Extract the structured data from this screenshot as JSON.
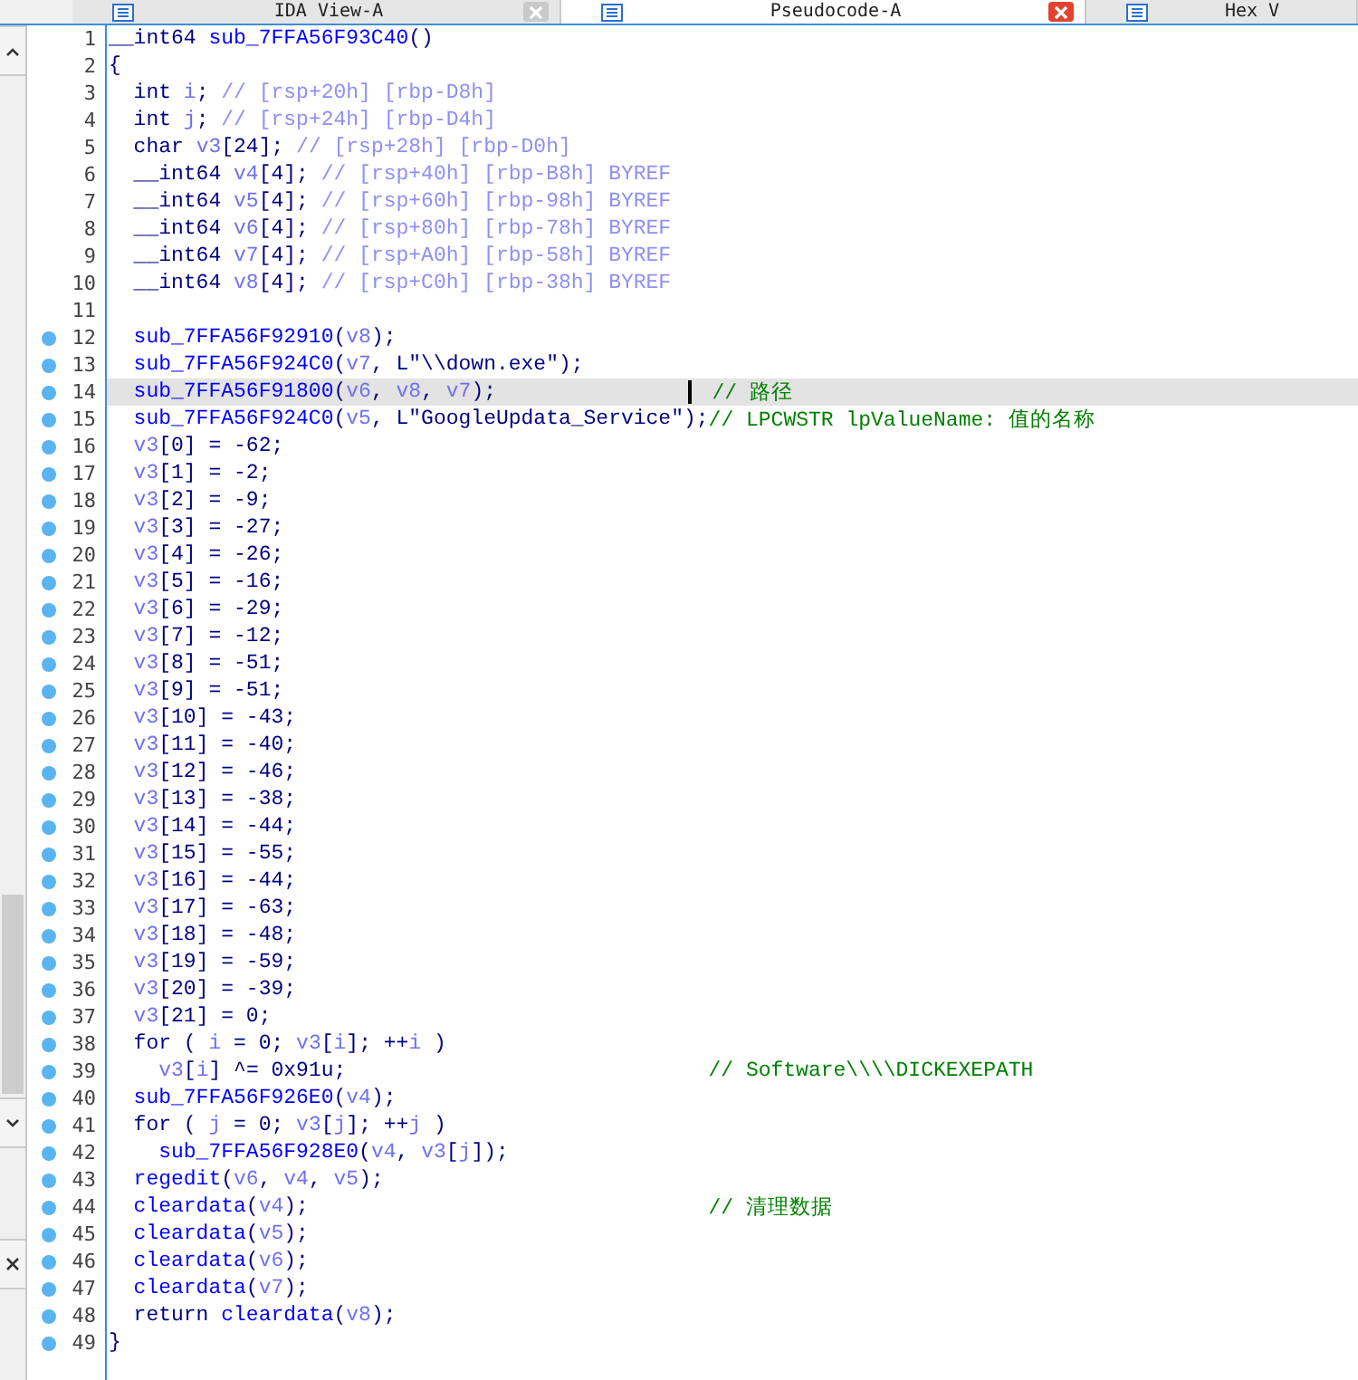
{
  "tabs": [
    {
      "label": "IDA View-A",
      "selected": false
    },
    {
      "label": "Pseudocode-A",
      "selected": true
    },
    {
      "label": "Hex V",
      "selected": false
    }
  ],
  "code": {
    "lines": [
      {
        "number": "1",
        "dot": false,
        "current": false,
        "tokens": [
          {
            "kind": "plain",
            "text": "__int64 "
          },
          {
            "kind": "func",
            "text": "sub_7FFA56F93C40"
          },
          {
            "kind": "plain",
            "text": "()"
          }
        ]
      },
      {
        "number": "2",
        "dot": false,
        "current": false,
        "tokens": [
          {
            "kind": "plain",
            "text": "{"
          }
        ]
      },
      {
        "number": "3",
        "dot": false,
        "current": false,
        "tokens": [
          {
            "kind": "plain",
            "text": "  int "
          },
          {
            "kind": "var",
            "text": "i"
          },
          {
            "kind": "plain",
            "text": "; "
          },
          {
            "kind": "stack",
            "text": "// [rsp+20h] [rbp-D8h]"
          }
        ]
      },
      {
        "number": "4",
        "dot": false,
        "current": false,
        "tokens": [
          {
            "kind": "plain",
            "text": "  int "
          },
          {
            "kind": "var",
            "text": "j"
          },
          {
            "kind": "plain",
            "text": "; "
          },
          {
            "kind": "stack",
            "text": "// [rsp+24h] [rbp-D4h]"
          }
        ]
      },
      {
        "number": "5",
        "dot": false,
        "current": false,
        "tokens": [
          {
            "kind": "plain",
            "text": "  char "
          },
          {
            "kind": "var",
            "text": "v3"
          },
          {
            "kind": "plain",
            "text": "[24]; "
          },
          {
            "kind": "stack",
            "text": "// [rsp+28h] [rbp-D0h]"
          }
        ]
      },
      {
        "number": "6",
        "dot": false,
        "current": false,
        "tokens": [
          {
            "kind": "plain",
            "text": "  __int64 "
          },
          {
            "kind": "var",
            "text": "v4"
          },
          {
            "kind": "plain",
            "text": "[4]; "
          },
          {
            "kind": "stack",
            "text": "// [rsp+40h] [rbp-B8h] BYREF"
          }
        ]
      },
      {
        "number": "7",
        "dot": false,
        "current": false,
        "tokens": [
          {
            "kind": "plain",
            "text": "  __int64 "
          },
          {
            "kind": "var",
            "text": "v5"
          },
          {
            "kind": "plain",
            "text": "[4]; "
          },
          {
            "kind": "stack",
            "text": "// [rsp+60h] [rbp-98h] BYREF"
          }
        ]
      },
      {
        "number": "8",
        "dot": false,
        "current": false,
        "tokens": [
          {
            "kind": "plain",
            "text": "  __int64 "
          },
          {
            "kind": "var",
            "text": "v6"
          },
          {
            "kind": "plain",
            "text": "[4]; "
          },
          {
            "kind": "stack",
            "text": "// [rsp+80h] [rbp-78h] BYREF"
          }
        ]
      },
      {
        "number": "9",
        "dot": false,
        "current": false,
        "tokens": [
          {
            "kind": "plain",
            "text": "  __int64 "
          },
          {
            "kind": "var",
            "text": "v7"
          },
          {
            "kind": "plain",
            "text": "[4]; "
          },
          {
            "kind": "stack",
            "text": "// [rsp+A0h] [rbp-58h] BYREF"
          }
        ]
      },
      {
        "number": "10",
        "dot": false,
        "current": false,
        "tokens": [
          {
            "kind": "plain",
            "text": "  __int64 "
          },
          {
            "kind": "var",
            "text": "v8"
          },
          {
            "kind": "plain",
            "text": "[4]; "
          },
          {
            "kind": "stack",
            "text": "// [rsp+C0h] [rbp-38h] BYREF"
          }
        ]
      },
      {
        "number": "11",
        "dot": false,
        "current": false
      },
      {
        "number": "12",
        "dot": true,
        "current": false,
        "tokens": [
          {
            "kind": "func",
            "text": "  sub_7FFA56F92910"
          },
          {
            "kind": "plain",
            "text": "("
          },
          {
            "kind": "var",
            "text": "v8"
          },
          {
            "kind": "plain",
            "text": ");"
          }
        ]
      },
      {
        "number": "13",
        "dot": true,
        "current": false,
        "tokens": [
          {
            "kind": "func",
            "text": "  sub_7FFA56F924C0"
          },
          {
            "kind": "plain",
            "text": "("
          },
          {
            "kind": "var",
            "text": "v7"
          },
          {
            "kind": "plain",
            "text": ", L\"\\\\down.exe\");"
          }
        ]
      },
      {
        "number": "14",
        "dot": true,
        "current": true,
        "tokens": [
          {
            "kind": "func",
            "text": "  sub_7FFA56F91800"
          },
          {
            "kind": "plain",
            "text": "("
          },
          {
            "kind": "var",
            "text": "v6"
          },
          {
            "kind": "plain",
            "text": ", "
          },
          {
            "kind": "var",
            "text": "v8"
          },
          {
            "kind": "plain",
            "text": ", "
          },
          {
            "kind": "var",
            "text": "v7"
          },
          {
            "kind": "plain",
            "text": ");"
          }
        ],
        "comment": "// 路径"
      },
      {
        "number": "15",
        "dot": true,
        "current": false,
        "tokens": [
          {
            "kind": "func",
            "text": "  sub_7FFA56F924C0"
          },
          {
            "kind": "plain",
            "text": "("
          },
          {
            "kind": "var",
            "text": "v5"
          },
          {
            "kind": "plain",
            "text": ", L\"GoogleUpdata_Service\");"
          }
        ],
        "comment": "// LPCWSTR lpValueName: 值的名称"
      },
      {
        "number": "16",
        "dot": true,
        "current": false,
        "tokens": [
          {
            "kind": "var",
            "text": "  v3"
          },
          {
            "kind": "plain",
            "text": "[0] = -62;"
          }
        ]
      },
      {
        "number": "17",
        "dot": true,
        "current": false,
        "tokens": [
          {
            "kind": "var",
            "text": "  v3"
          },
          {
            "kind": "plain",
            "text": "[1] = -2;"
          }
        ]
      },
      {
        "number": "18",
        "dot": true,
        "current": false,
        "tokens": [
          {
            "kind": "var",
            "text": "  v3"
          },
          {
            "kind": "plain",
            "text": "[2] = -9;"
          }
        ]
      },
      {
        "number": "19",
        "dot": true,
        "current": false,
        "tokens": [
          {
            "kind": "var",
            "text": "  v3"
          },
          {
            "kind": "plain",
            "text": "[3] = -27;"
          }
        ]
      },
      {
        "number": "20",
        "dot": true,
        "current": false,
        "tokens": [
          {
            "kind": "var",
            "text": "  v3"
          },
          {
            "kind": "plain",
            "text": "[4] = -26;"
          }
        ]
      },
      {
        "number": "21",
        "dot": true,
        "current": false,
        "tokens": [
          {
            "kind": "var",
            "text": "  v3"
          },
          {
            "kind": "plain",
            "text": "[5] = -16;"
          }
        ]
      },
      {
        "number": "22",
        "dot": true,
        "current": false,
        "tokens": [
          {
            "kind": "var",
            "text": "  v3"
          },
          {
            "kind": "plain",
            "text": "[6] = -29;"
          }
        ]
      },
      {
        "number": "23",
        "dot": true,
        "current": false,
        "tokens": [
          {
            "kind": "var",
            "text": "  v3"
          },
          {
            "kind": "plain",
            "text": "[7] = -12;"
          }
        ]
      },
      {
        "number": "24",
        "dot": true,
        "current": false,
        "tokens": [
          {
            "kind": "var",
            "text": "  v3"
          },
          {
            "kind": "plain",
            "text": "[8] = -51;"
          }
        ]
      },
      {
        "number": "25",
        "dot": true,
        "current": false,
        "tokens": [
          {
            "kind": "var",
            "text": "  v3"
          },
          {
            "kind": "plain",
            "text": "[9] = -51;"
          }
        ]
      },
      {
        "number": "26",
        "dot": true,
        "current": false,
        "tokens": [
          {
            "kind": "var",
            "text": "  v3"
          },
          {
            "kind": "plain",
            "text": "[10] = -43;"
          }
        ]
      },
      {
        "number": "27",
        "dot": true,
        "current": false,
        "tokens": [
          {
            "kind": "var",
            "text": "  v3"
          },
          {
            "kind": "plain",
            "text": "[11] = -40;"
          }
        ]
      },
      {
        "number": "28",
        "dot": true,
        "current": false,
        "tokens": [
          {
            "kind": "var",
            "text": "  v3"
          },
          {
            "kind": "plain",
            "text": "[12] = -46;"
          }
        ]
      },
      {
        "number": "29",
        "dot": true,
        "current": false,
        "tokens": [
          {
            "kind": "var",
            "text": "  v3"
          },
          {
            "kind": "plain",
            "text": "[13] = -38;"
          }
        ]
      },
      {
        "number": "30",
        "dot": true,
        "current": false,
        "tokens": [
          {
            "kind": "var",
            "text": "  v3"
          },
          {
            "kind": "plain",
            "text": "[14] = -44;"
          }
        ]
      },
      {
        "number": "31",
        "dot": true,
        "current": false,
        "tokens": [
          {
            "kind": "var",
            "text": "  v3"
          },
          {
            "kind": "plain",
            "text": "[15] = -55;"
          }
        ]
      },
      {
        "number": "32",
        "dot": true,
        "current": false,
        "tokens": [
          {
            "kind": "var",
            "text": "  v3"
          },
          {
            "kind": "plain",
            "text": "[16] = -44;"
          }
        ]
      },
      {
        "number": "33",
        "dot": true,
        "current": false,
        "tokens": [
          {
            "kind": "var",
            "text": "  v3"
          },
          {
            "kind": "plain",
            "text": "[17] = -63;"
          }
        ]
      },
      {
        "number": "34",
        "dot": true,
        "current": false,
        "tokens": [
          {
            "kind": "var",
            "text": "  v3"
          },
          {
            "kind": "plain",
            "text": "[18] = -48;"
          }
        ]
      },
      {
        "number": "35",
        "dot": true,
        "current": false,
        "tokens": [
          {
            "kind": "var",
            "text": "  v3"
          },
          {
            "kind": "plain",
            "text": "[19] = -59;"
          }
        ]
      },
      {
        "number": "36",
        "dot": true,
        "current": false,
        "tokens": [
          {
            "kind": "var",
            "text": "  v3"
          },
          {
            "kind": "plain",
            "text": "[20] = -39;"
          }
        ]
      },
      {
        "number": "37",
        "dot": true,
        "current": false,
        "tokens": [
          {
            "kind": "var",
            "text": "  v3"
          },
          {
            "kind": "plain",
            "text": "[21] = 0;"
          }
        ]
      },
      {
        "number": "38",
        "dot": true,
        "current": false,
        "tokens": [
          {
            "kind": "plain",
            "text": "  for ( "
          },
          {
            "kind": "var",
            "text": "i"
          },
          {
            "kind": "plain",
            "text": " = 0; "
          },
          {
            "kind": "var",
            "text": "v3"
          },
          {
            "kind": "plain",
            "text": "["
          },
          {
            "kind": "var",
            "text": "i"
          },
          {
            "kind": "plain",
            "text": "]; ++"
          },
          {
            "kind": "var",
            "text": "i"
          },
          {
            "kind": "plain",
            "text": " )"
          }
        ]
      },
      {
        "number": "39",
        "dot": true,
        "current": false,
        "tokens": [
          {
            "kind": "var",
            "text": "    v3"
          },
          {
            "kind": "plain",
            "text": "["
          },
          {
            "kind": "var",
            "text": "i"
          },
          {
            "kind": "plain",
            "text": "] ^= 0x91u;"
          }
        ],
        "comment": "// Software\\\\\\\\DICKEXEPATH"
      },
      {
        "number": "40",
        "dot": true,
        "current": false,
        "tokens": [
          {
            "kind": "func",
            "text": "  sub_7FFA56F926E0"
          },
          {
            "kind": "plain",
            "text": "("
          },
          {
            "kind": "var",
            "text": "v4"
          },
          {
            "kind": "plain",
            "text": ");"
          }
        ]
      },
      {
        "number": "41",
        "dot": true,
        "current": false,
        "tokens": [
          {
            "kind": "plain",
            "text": "  for ( "
          },
          {
            "kind": "var",
            "text": "j"
          },
          {
            "kind": "plain",
            "text": " = 0; "
          },
          {
            "kind": "var",
            "text": "v3"
          },
          {
            "kind": "plain",
            "text": "["
          },
          {
            "kind": "var",
            "text": "j"
          },
          {
            "kind": "plain",
            "text": "]; ++"
          },
          {
            "kind": "var",
            "text": "j"
          },
          {
            "kind": "plain",
            "text": " )"
          }
        ]
      },
      {
        "number": "42",
        "dot": true,
        "current": false,
        "tokens": [
          {
            "kind": "func",
            "text": "    sub_7FFA56F928E0"
          },
          {
            "kind": "plain",
            "text": "("
          },
          {
            "kind": "var",
            "text": "v4"
          },
          {
            "kind": "plain",
            "text": ", "
          },
          {
            "kind": "var",
            "text": "v3"
          },
          {
            "kind": "plain",
            "text": "["
          },
          {
            "kind": "var",
            "text": "j"
          },
          {
            "kind": "plain",
            "text": "]);"
          }
        ]
      },
      {
        "number": "43",
        "dot": true,
        "current": false,
        "tokens": [
          {
            "kind": "func",
            "text": "  regedit"
          },
          {
            "kind": "plain",
            "text": "("
          },
          {
            "kind": "var",
            "text": "v6"
          },
          {
            "kind": "plain",
            "text": ", "
          },
          {
            "kind": "var",
            "text": "v4"
          },
          {
            "kind": "plain",
            "text": ", "
          },
          {
            "kind": "var",
            "text": "v5"
          },
          {
            "kind": "plain",
            "text": ");"
          }
        ]
      },
      {
        "number": "44",
        "dot": true,
        "current": false,
        "tokens": [
          {
            "kind": "func",
            "text": "  cleardata"
          },
          {
            "kind": "plain",
            "text": "("
          },
          {
            "kind": "var",
            "text": "v4"
          },
          {
            "kind": "plain",
            "text": ");"
          }
        ],
        "comment": "// 清理数据"
      },
      {
        "number": "45",
        "dot": true,
        "current": false,
        "tokens": [
          {
            "kind": "func",
            "text": "  cleardata"
          },
          {
            "kind": "plain",
            "text": "("
          },
          {
            "kind": "var",
            "text": "v5"
          },
          {
            "kind": "plain",
            "text": ");"
          }
        ]
      },
      {
        "number": "46",
        "dot": true,
        "current": false,
        "tokens": [
          {
            "kind": "func",
            "text": "  cleardata"
          },
          {
            "kind": "plain",
            "text": "("
          },
          {
            "kind": "var",
            "text": "v6"
          },
          {
            "kind": "plain",
            "text": ");"
          }
        ]
      },
      {
        "number": "47",
        "dot": true,
        "current": false,
        "tokens": [
          {
            "kind": "func",
            "text": "  cleardata"
          },
          {
            "kind": "plain",
            "text": "("
          },
          {
            "kind": "var",
            "text": "v7"
          },
          {
            "kind": "plain",
            "text": ");"
          }
        ]
      },
      {
        "number": "48",
        "dot": true,
        "current": false,
        "tokens": [
          {
            "kind": "plain",
            "text": "  return "
          },
          {
            "kind": "func",
            "text": "cleardata"
          },
          {
            "kind": "plain",
            "text": "("
          },
          {
            "kind": "var",
            "text": "v8"
          },
          {
            "kind": "plain",
            "text": ");"
          }
        ]
      },
      {
        "number": "49",
        "dot": true,
        "current": false,
        "tokens": [
          {
            "kind": "plain",
            "text": "}"
          }
        ]
      }
    ]
  }
}
